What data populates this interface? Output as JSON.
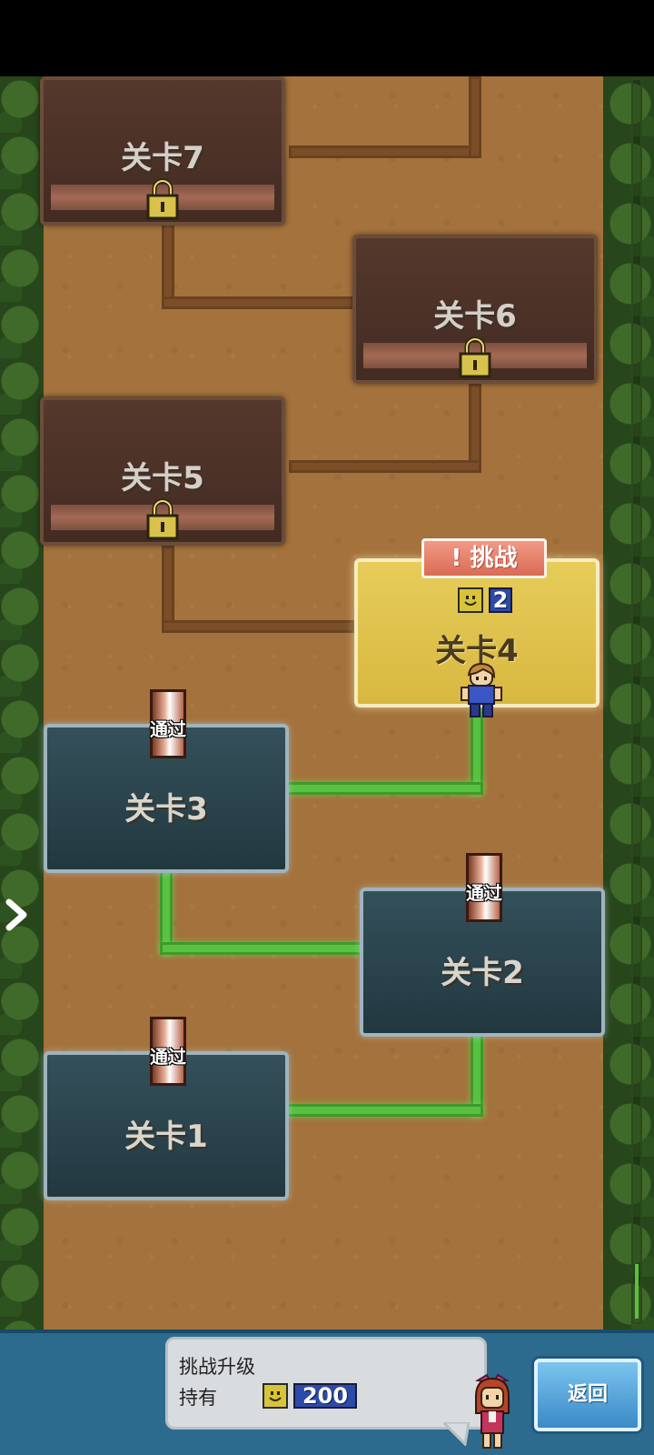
{
  "levels": [
    {
      "label": "关卡7",
      "state": "locked"
    },
    {
      "label": "关卡6",
      "state": "locked"
    },
    {
      "label": "关卡5",
      "state": "locked"
    },
    {
      "label": "关卡4",
      "state": "current"
    },
    {
      "label": "关卡3",
      "state": "cleared"
    },
    {
      "label": "关卡2",
      "state": "cleared"
    },
    {
      "label": "关卡1",
      "state": "cleared"
    }
  ],
  "pass_label": "通过",
  "challenge": {
    "tag": "! 挑战",
    "cost": "2"
  },
  "bottom": {
    "title": "挑战升级",
    "owned_label": "持有",
    "owned_value": "200",
    "return_label": "返回"
  }
}
